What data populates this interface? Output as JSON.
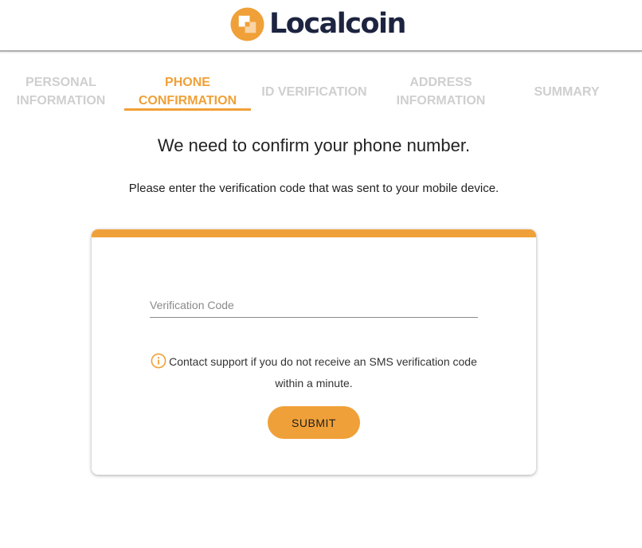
{
  "brand": {
    "name": "Localcoin",
    "accent_color": "#f0a038",
    "text_color": "#1d2440"
  },
  "steps": [
    {
      "label": "PERSONAL\nINFORMATION",
      "active": false
    },
    {
      "label": "PHONE\nCONFIRMATION",
      "active": true
    },
    {
      "label": "ID VERIFICATION",
      "active": false
    },
    {
      "label": "ADDRESS\nINFORMATION",
      "active": false
    },
    {
      "label": "SUMMARY",
      "active": false
    }
  ],
  "main": {
    "title": "We need to confirm your phone number.",
    "subtitle": "Please enter the verification code that was sent to your mobile device."
  },
  "form": {
    "code_placeholder": "Verification Code",
    "code_value": "",
    "notice_line1": "Contact support if you do not receive an SMS verification code",
    "notice_line2": "within a minute.",
    "notice_icon": "info-icon",
    "submit_label": "SUBMIT"
  }
}
